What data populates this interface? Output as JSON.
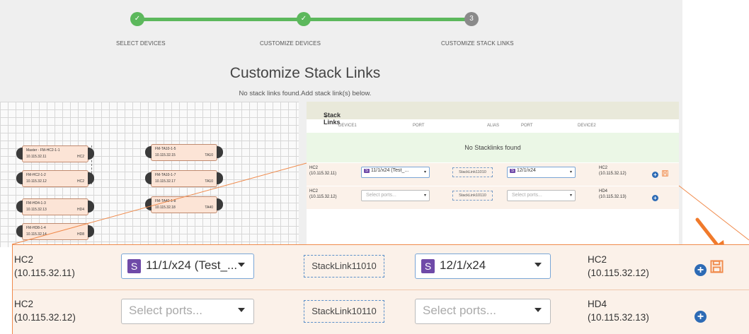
{
  "wizard": {
    "steps": [
      {
        "label": "SELECT DEVICES",
        "marker": "✓"
      },
      {
        "label": "CUSTOMIZE DEVICES",
        "marker": "✓"
      },
      {
        "label": "CUSTOMIZE STACK LINKS",
        "marker": "3"
      }
    ],
    "colors": {
      "done": "#5cb85c",
      "pending": "#8a8a8a"
    }
  },
  "page": {
    "title": "Customize Stack Links",
    "subtitle": "No stack links found.Add stack link(s) below."
  },
  "topology": {
    "nodes": [
      {
        "name": "Master - FM-HC2-1-1",
        "ip": "10.115.32.11",
        "model": "HC2"
      },
      {
        "name": "FM-HC2-1-2",
        "ip": "10.115.32.12",
        "model": "HC2"
      },
      {
        "name": "FM-HD4-1-3",
        "ip": "10.115.32.13",
        "model": "HD4"
      },
      {
        "name": "FM-HD8-1-4",
        "ip": "10.115.32.14",
        "model": "HD8"
      },
      {
        "name": "FM-TA10-1-5",
        "ip": "10.115.32.15",
        "model": "TA10"
      },
      {
        "name": "FM-TA10-1-7",
        "ip": "10.115.32.17",
        "model": "TA10"
      },
      {
        "name": "FM-TA40-1-8",
        "ip": "10.115.32.18",
        "model": "TA40"
      }
    ]
  },
  "stack_links": {
    "header": "Stack Links",
    "columns": [
      "DEVICE1",
      "PORT",
      "ALIAS",
      "PORT",
      "DEVICE2"
    ],
    "empty_message": "No Stacklinks found",
    "rows": [
      {
        "device1_name": "HC2",
        "device1_ip": "(10.115.32.11)",
        "port1_badge": "S",
        "port1_value": "11/1/x24 (Test_...",
        "port1_value_small": "11/1/x24 (Test_...",
        "alias": "StackLink11010",
        "port2_badge": "S",
        "port2_value": "12/1/x24",
        "device2_name": "HC2",
        "device2_ip": "(10.115.32.12)"
      },
      {
        "device1_name": "HC2",
        "device1_ip": "(10.115.32.12)",
        "port1_placeholder": "Select ports...",
        "alias": "StackLink10110",
        "port2_placeholder": "Select ports...",
        "device2_name": "HD4",
        "device2_ip": "(10.115.32.13)"
      }
    ],
    "icons": [
      "plus-circle-icon",
      "save-icon",
      "caret-down-icon",
      "chevron-down-icon",
      "arrow-icon"
    ]
  },
  "colors": {
    "accent_orange": "#f08a4b",
    "badge_purple": "#6f4aa8",
    "row_bg": "#fbf1e9",
    "empty_bg": "#ebf7e6",
    "plus_blue": "#2d6bb5"
  }
}
